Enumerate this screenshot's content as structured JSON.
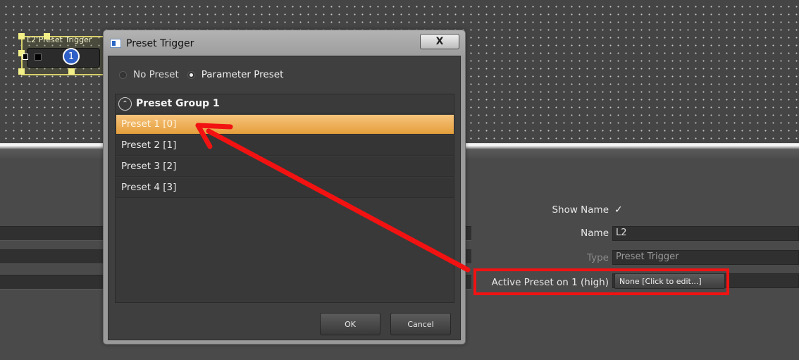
{
  "canvas": {
    "block_label": "L2  Preset Trigger",
    "block_number": "1"
  },
  "properties": {
    "show_name_label": "Show Name",
    "show_name_check": "✓",
    "name_label": "Name",
    "name_value": "L2",
    "type_label": "Type",
    "type_value": "Preset Trigger",
    "active_preset_label": "Active Preset on 1 (high)",
    "active_preset_button": "None [Click to edit...]"
  },
  "dialog": {
    "title": "Preset Trigger",
    "close_label": "X",
    "radio_no_preset": "No Preset",
    "radio_parameter_preset": "Parameter Preset",
    "selected_mode": "Parameter Preset",
    "group": {
      "chevron": "^",
      "label": "Preset Group 1"
    },
    "presets": [
      {
        "label": "Preset 1 [0]",
        "selected": true
      },
      {
        "label": "Preset 2 [1]",
        "selected": false
      },
      {
        "label": "Preset 3 [2]",
        "selected": false
      },
      {
        "label": "Preset 4 [3]",
        "selected": false
      }
    ],
    "ok_label": "OK",
    "cancel_label": "Cancel"
  },
  "colors": {
    "selection_orange": "#e59f3c",
    "highlight_red": "#f21212",
    "badge_blue": "#2f60c7",
    "selection_yellow": "#f2ef88"
  }
}
